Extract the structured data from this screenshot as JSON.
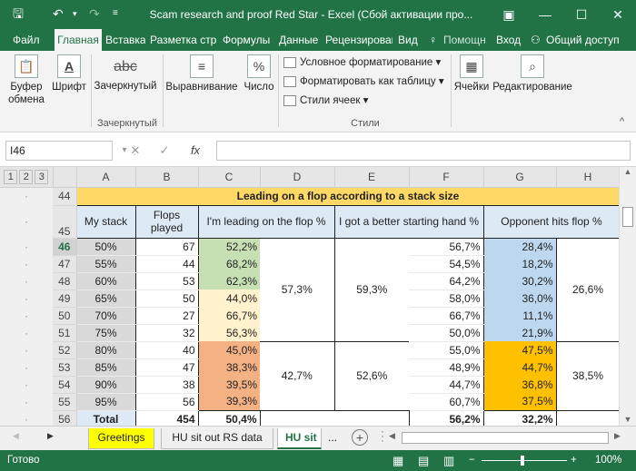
{
  "title": "Scam research and proof Red Star - Excel (Сбой активации про...",
  "tabs": [
    "Файл",
    "Главная",
    "Вставка",
    "Разметка стра",
    "Формулы",
    "Данные",
    "Рецензирован",
    "Вид"
  ],
  "tellme": "Помощн",
  "login": "Вход",
  "share": "Общий доступ",
  "ribbon": {
    "clipboard": "Буфер\nобмена",
    "font": "Шрифт",
    "strike_label": "abc",
    "strike": "Зачеркнутый",
    "strike_group": "Зачеркнутый",
    "align": "Выравнивание",
    "number": "Число",
    "cond": "Условное форматирование",
    "asTable": "Форматировать как таблицу",
    "styles": "Стили ячеек",
    "stylesGroup": "Стили",
    "cells": "Ячейки",
    "edit": "Редактирование"
  },
  "namebox": "I46",
  "outline_levels": [
    "1",
    "2",
    "3"
  ],
  "columns": [
    "A",
    "B",
    "C",
    "D",
    "E",
    "F",
    "G",
    "H"
  ],
  "title_row": "Leading on a flop according to a stack size",
  "headers": {
    "a": "My stack",
    "b": "Flops played",
    "c": "I'm leading on the flop %",
    "e": "I got a better starting hand %",
    "g": "Opponent hits flop %"
  },
  "rows": [
    {
      "n": "46",
      "a": "50%",
      "b": "67",
      "c": "52,2%",
      "f": "56,7%",
      "g": "28,4%"
    },
    {
      "n": "47",
      "a": "55%",
      "b": "44",
      "c": "68,2%",
      "f": "54,5%",
      "g": "18,2%"
    },
    {
      "n": "48",
      "a": "60%",
      "b": "53",
      "c": "62,3%",
      "f": "64,2%",
      "g": "30,2%"
    },
    {
      "n": "49",
      "a": "65%",
      "b": "50",
      "c": "44,0%",
      "f": "58,0%",
      "g": "36,0%"
    },
    {
      "n": "50",
      "a": "70%",
      "b": "27",
      "c": "66,7%",
      "f": "66,7%",
      "g": "11,1%"
    },
    {
      "n": "51",
      "a": "75%",
      "b": "32",
      "c": "56,3%",
      "f": "50,0%",
      "g": "21,9%"
    },
    {
      "n": "52",
      "a": "80%",
      "b": "40",
      "c": "45,0%",
      "f": "55,0%",
      "g": "47,5%"
    },
    {
      "n": "53",
      "a": "85%",
      "b": "47",
      "c": "38,3%",
      "f": "48,9%",
      "g": "44,7%"
    },
    {
      "n": "54",
      "a": "90%",
      "b": "38",
      "c": "39,5%",
      "f": "44,7%",
      "g": "36,8%"
    },
    {
      "n": "55",
      "a": "95%",
      "b": "56",
      "c": "39,3%",
      "f": "60,7%",
      "g": "37,5%"
    }
  ],
  "merged": {
    "d1": "57,3%",
    "e1": "59,3%",
    "h1": "26,6%",
    "d2": "42,7%",
    "e2": "52,6%",
    "h2": "38,5%"
  },
  "total": {
    "n": "56",
    "a": "Total",
    "b": "454",
    "c": "50,4%",
    "f": "56,2%",
    "g": "32,2%"
  },
  "sheets": [
    "Greetings",
    "HU sit out RS data",
    "HU sit",
    "..."
  ],
  "status": "Готово",
  "zoom": "100%"
}
